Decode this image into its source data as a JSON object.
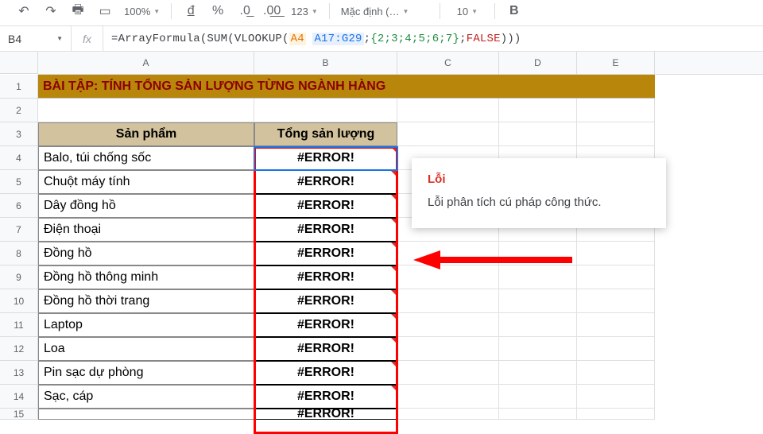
{
  "toolbar": {
    "zoom": "100%",
    "format_menu": "123",
    "font": "Mặc định (…",
    "font_size": "10"
  },
  "formula_bar": {
    "cell_ref": "B4",
    "formula_prefix": "=ArrayFormula(SUM(VLOOKUP(",
    "ref1": "A4",
    "ref2": "A17:G29",
    "arr": "{2;3;4;5;6;7}",
    "false_tok": "FALSE",
    "formula_suffix": ")))"
  },
  "columns": [
    "A",
    "B",
    "C",
    "D",
    "E"
  ],
  "title": "BÀI TẬP: TÍNH TỔNG SẢN LƯỢNG TỪNG NGÀNH HÀNG",
  "headers": {
    "col_a": "Sản phẩm",
    "col_b": "Tổng sản lượng"
  },
  "errorText": "#ERROR!",
  "products": [
    "Balo, túi chống sốc",
    "Chuột máy tính",
    "Dây đồng hồ",
    "Điện thoại",
    "Đồng hồ",
    "Đồng hồ thông minh",
    "Đồng hồ thời trang",
    "Laptop",
    "Loa",
    "Pin sạc dự phòng",
    "Sạc, cáp"
  ],
  "popup": {
    "title": "Lỗi",
    "body": "Lỗi phân tích cú pháp công thức."
  }
}
